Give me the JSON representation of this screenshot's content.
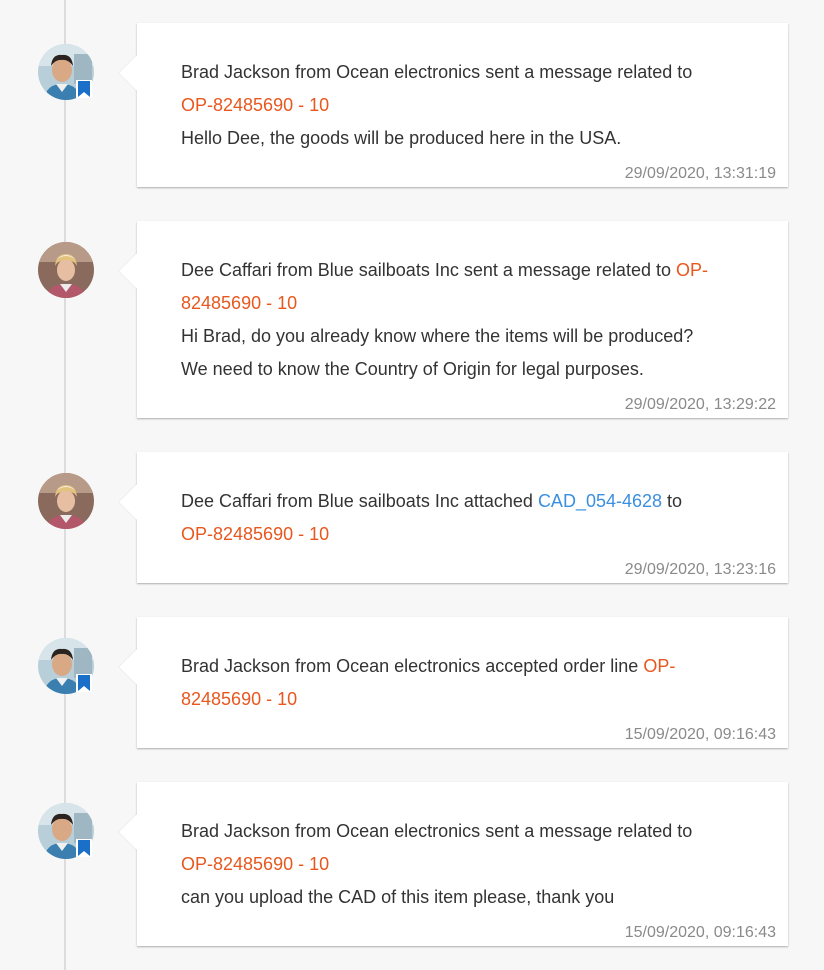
{
  "entries": [
    {
      "author": "Brad Jackson",
      "company": "Ocean electronics",
      "action": "sent a message related to",
      "order_ref": "OP-82485690 - 10",
      "message_lines": [
        "Hello Dee, the goods will be produced here in the USA."
      ],
      "timestamp": "29/09/2020, 13:31:19"
    },
    {
      "author": "Dee Caffari",
      "company": "Blue sailboats Inc",
      "action": "sent a message related to",
      "order_ref_part1": "OP-",
      "order_ref_part2": "82485690 - 10",
      "message_lines": [
        "Hi Brad, do you already know where the items will be produced?",
        "We need to know the Country of Origin for legal purposes."
      ],
      "timestamp": "29/09/2020, 13:29:22"
    },
    {
      "author": "Dee Caffari",
      "company": "Blue sailboats Inc",
      "action": "attached",
      "attachment": "CAD_054-4628",
      "connector": "to",
      "order_ref": "OP-82485690 - 10",
      "timestamp": "29/09/2020, 13:23:16"
    },
    {
      "author": "Brad Jackson",
      "company": "Ocean electronics",
      "action": "accepted order line",
      "order_ref_part1": "OP-",
      "order_ref_part2": "82485690 - 10",
      "timestamp": "15/09/2020, 09:16:43"
    },
    {
      "author": "Brad Jackson",
      "company": "Ocean electronics",
      "action": "sent a message related to",
      "order_ref": "OP-82485690 - 10",
      "message_lines": [
        "can you upload the CAD of this item please, thank you"
      ],
      "timestamp": "15/09/2020, 09:16:43"
    }
  ],
  "words": {
    "from": "from"
  },
  "colors": {
    "order_ref": "#e8571e",
    "attachment_link": "#3b8fe0",
    "badge": "#1a6fc9",
    "timestamp": "#8a8a8a"
  },
  "icons": {
    "supplier_badge": "bookmark-icon"
  }
}
